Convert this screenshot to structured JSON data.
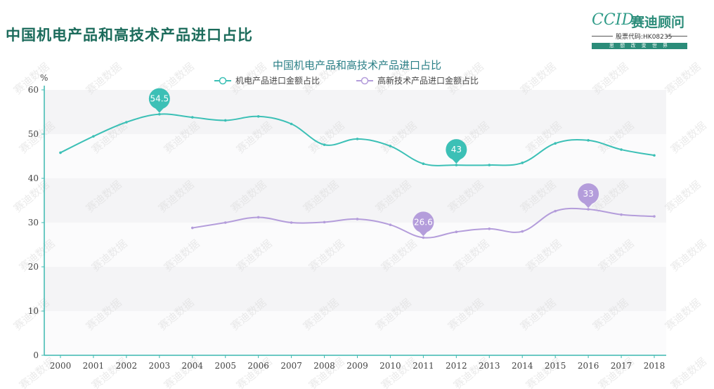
{
  "page": {
    "title": "中国机电产品和高技术产品进口占比"
  },
  "logo": {
    "wordmark": "CCID",
    "name": "赛迪顾问",
    "stock_code": "股票代码:HK08235",
    "slogan": "思 想 改 变 世 界",
    "colors": {
      "brand": "#2b8c79"
    }
  },
  "watermark": {
    "text": "赛迪数据"
  },
  "chart_data": {
    "type": "line",
    "title": "中国机电产品和高技术产品进口占比",
    "ylabel": "%",
    "ylim": [
      0,
      60
    ],
    "yticks": [
      0,
      10,
      20,
      30,
      40,
      50,
      60
    ],
    "grid": "horizontal bands",
    "legend_position": "top",
    "x": [
      "2000",
      "2001",
      "2002",
      "2003",
      "2004",
      "2005",
      "2006",
      "2007",
      "2008",
      "2009",
      "2010",
      "2011",
      "2012",
      "2013",
      "2014",
      "2015",
      "2016",
      "2017",
      "2018"
    ],
    "series": [
      {
        "name": "机电产品进口金额占比",
        "color": "#3cc0b6",
        "values": [
          45.8,
          49.5,
          52.7,
          54.5,
          53.8,
          53.1,
          54.0,
          52.3,
          47.6,
          48.9,
          47.3,
          43.3,
          43.0,
          43.0,
          43.5,
          47.9,
          48.6,
          46.5,
          45.2
        ],
        "max_label": {
          "x": "2003",
          "value": "54.5"
        },
        "min_label": {
          "x": "2012",
          "value": "43"
        }
      },
      {
        "name": "高新技术产品进口金额占比",
        "color": "#b49ddb",
        "values": [
          null,
          null,
          null,
          null,
          28.8,
          30.0,
          31.2,
          30.0,
          30.1,
          30.8,
          29.5,
          26.6,
          27.9,
          28.6,
          28.0,
          32.6,
          33.0,
          31.8,
          31.4
        ],
        "max_label": {
          "x": "2016",
          "value": "33"
        },
        "min_label": {
          "x": "2011",
          "value": "26.6"
        }
      }
    ]
  }
}
